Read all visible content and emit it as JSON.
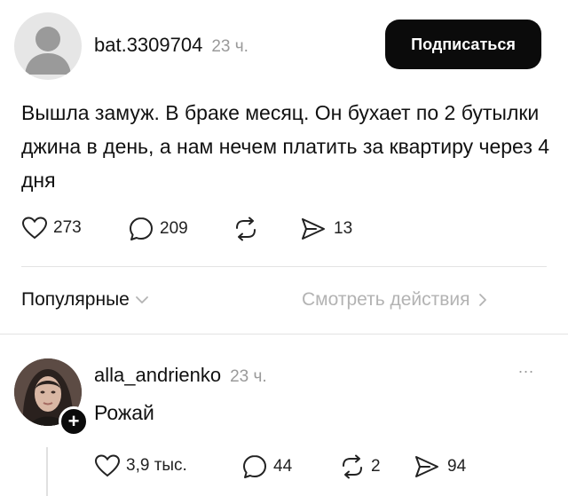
{
  "post": {
    "author": "bat.3309704",
    "time": "23 ч.",
    "subscribe_label": "Подписаться",
    "text": "Вышла замуж. В браке месяц. Он бухает по 2 бутылки джина в день, а нам нечем платить за квартиру через 4 дня",
    "likes": "273",
    "comments": "209",
    "shares": "13"
  },
  "tabs": {
    "popular_label": "Популярные",
    "view_actions_label": "Смотреть действия"
  },
  "reply": {
    "author": "alla_andrienko",
    "time": "23 ч.",
    "more": "...",
    "text": "Рожай",
    "likes": "3,9 тыс.",
    "comments": "44",
    "reposts": "2",
    "shares": "94"
  },
  "icons": {
    "heart": "heart-icon",
    "comment": "comment-bubble-icon",
    "repost": "repost-icon",
    "share": "send-icon",
    "chevron_down": "chevron-down-icon",
    "chevron_right": "chevron-right-icon",
    "plus": "plus-icon"
  },
  "colors": {
    "button_bg": "#0b0b0b",
    "muted": "#9a9a9a"
  }
}
